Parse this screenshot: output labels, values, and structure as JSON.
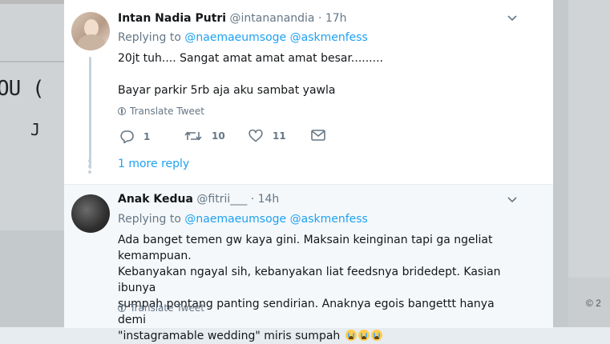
{
  "footer": {
    "copyright": "© 2"
  },
  "tweets": [
    {
      "name": "Intan Nadia Putri",
      "handle": "@intananandia",
      "time": "· 17h",
      "replying_label": "Replying to",
      "mentions": [
        "@naemaeumsoge",
        "@askmenfess"
      ],
      "lines": [
        "20jt tuh.... Sangat amat amat amat besar.........",
        "",
        "Bayar parkir 5rb aja aku sambat yawla"
      ],
      "translate": "Translate Tweet",
      "actions": {
        "reply_count": "1",
        "retweet_count": "10",
        "like_count": "11"
      },
      "more_replies": "1 more reply"
    },
    {
      "name": "Anak Kedua",
      "handle": "@fitrii___",
      "time": "· 14h",
      "replying_label": "Replying to",
      "mentions": [
        "@naemaeumsoge",
        "@askmenfess"
      ],
      "lines": [
        "Ada banget temen gw kaya gini. Maksain keinginan tapi ga ngeliat kemampuan.",
        "Kebanyakan ngayal sih, kebanyakan liat feedsnya bridedept. Kasian ibunya",
        "sumpah pontang panting sendirian. Anaknya egois bangettt hanya demi",
        "\"instagramable wedding\" miris sumpah"
      ],
      "translate": "Translate Tweet"
    }
  ],
  "background_text": {
    "big": "OU (",
    "small": "J"
  }
}
